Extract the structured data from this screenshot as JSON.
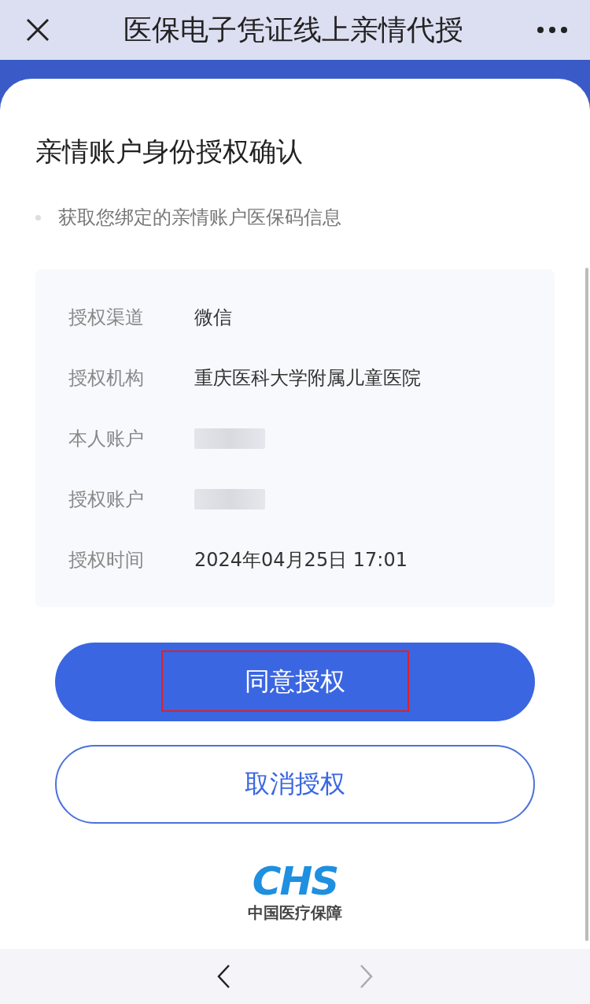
{
  "window": {
    "title": "医保电子凭证线上亲情代授"
  },
  "card": {
    "title": "亲情账户身份授权确认",
    "bullets": [
      "获取您绑定的亲情账户医保码信息"
    ]
  },
  "details": [
    {
      "label": "授权渠道",
      "kind": "text",
      "value": "微信"
    },
    {
      "label": "授权机构",
      "kind": "text",
      "value": "重庆医科大学附属儿童医院"
    },
    {
      "label": "本人账户",
      "kind": "redacted"
    },
    {
      "label": "授权账户",
      "kind": "redacted"
    },
    {
      "label": "授权时间",
      "kind": "text",
      "value": "2024年04月25日 17:01"
    }
  ],
  "buttons": [
    {
      "label": "同意授权",
      "kind": "primary",
      "highlighted": true
    },
    {
      "label": "取消授权",
      "kind": "secondary",
      "highlighted": false
    }
  ],
  "logo": {
    "mark": "CHS",
    "caption": "中国医疗保障"
  },
  "nav": {
    "back_enabled": true,
    "forward_enabled": false
  }
}
